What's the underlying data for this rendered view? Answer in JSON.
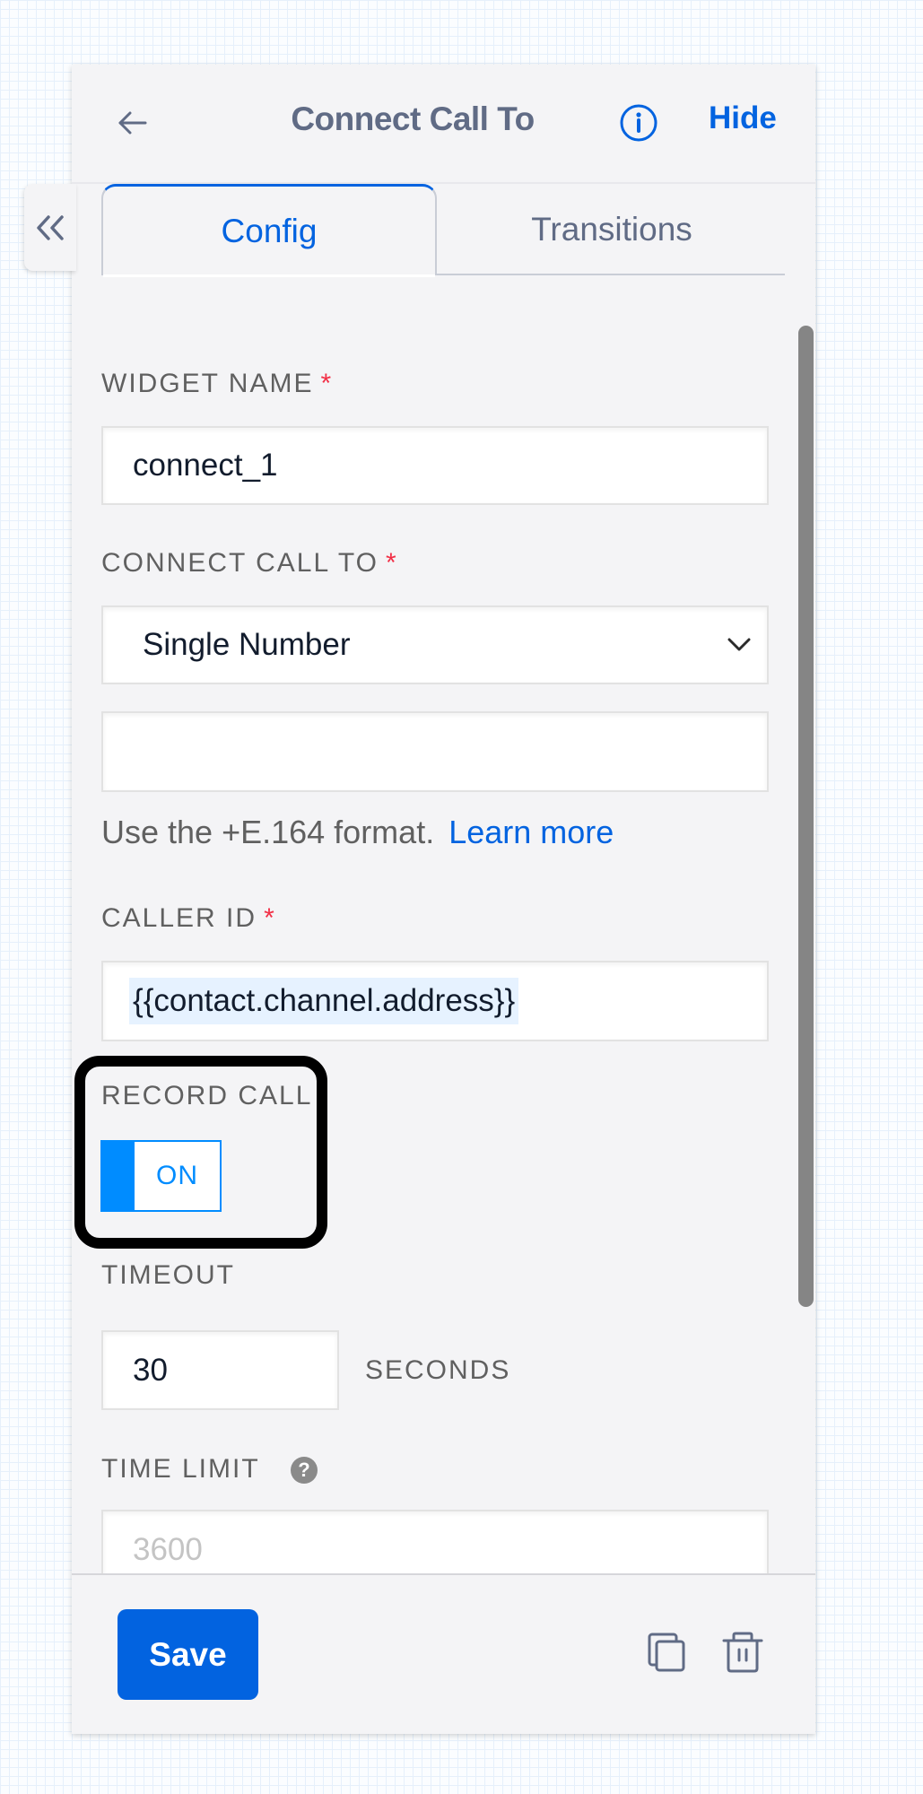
{
  "header": {
    "title": "Connect Call To",
    "hide_label": "Hide",
    "back_icon": "arrow-left-icon",
    "info_icon": "info-icon",
    "collapse_icon": "double-chevron-left-icon"
  },
  "tabs": [
    {
      "label": "Config",
      "active": true
    },
    {
      "label": "Transitions",
      "active": false
    }
  ],
  "form": {
    "widget_name": {
      "label": "WIDGET NAME",
      "required": "*",
      "value": "connect_1"
    },
    "connect_call_to": {
      "label": "CONNECT CALL TO",
      "required": "*",
      "selected": "Single Number"
    },
    "phone_number": {
      "value": "",
      "helper": "Use the +E.164 format.",
      "helper_link": "Learn more"
    },
    "caller_id": {
      "label": "CALLER ID",
      "required": "*",
      "value": "{{contact.channel.address}}"
    },
    "record_call": {
      "label": "RECORD CALL",
      "state": "ON",
      "enabled": true
    },
    "timeout": {
      "label": "TIMEOUT",
      "value": "30",
      "unit": "SECONDS"
    },
    "time_limit": {
      "label": "TIME LIMIT",
      "placeholder": "3600",
      "help_icon": "question-circle-icon"
    }
  },
  "footer": {
    "save_label": "Save",
    "duplicate_icon": "copy-icon",
    "delete_icon": "trash-icon"
  },
  "colors": {
    "accent": "#0263e0",
    "toggle": "#008cff",
    "required": "#f22f46",
    "highlight_box": "#000000"
  }
}
